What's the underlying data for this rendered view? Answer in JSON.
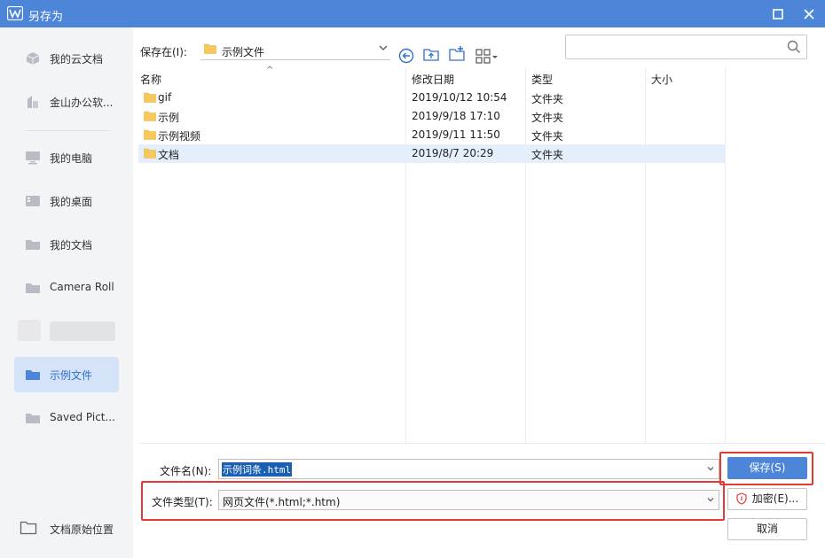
{
  "window": {
    "title": "另存为"
  },
  "sidebar": {
    "items": [
      {
        "label": "我的云文档"
      },
      {
        "label": "金山办公软..."
      },
      {
        "label": "我的电脑"
      },
      {
        "label": "我的桌面"
      },
      {
        "label": "我的文档"
      },
      {
        "label": "Camera Roll"
      },
      {
        "label": "示例文件"
      },
      {
        "label": "Saved Pict..."
      }
    ],
    "bottom_label": "文档原始位置"
  },
  "toolbar": {
    "save_in_label": "保存在(I):",
    "current_folder": "示例文件",
    "search_placeholder": ""
  },
  "filelist": {
    "columns": [
      "名称",
      "修改日期",
      "类型",
      "大小"
    ],
    "rows": [
      {
        "name": "gif",
        "date": "2019/10/12 10:54",
        "type": "文件夹"
      },
      {
        "name": "示例",
        "date": "2019/9/18 17:10",
        "type": "文件夹"
      },
      {
        "name": "示例视频",
        "date": "2019/9/11 11:50",
        "type": "文件夹"
      },
      {
        "name": "文档",
        "date": "2019/8/7 20:29",
        "type": "文件夹"
      }
    ]
  },
  "form": {
    "filename_label": "文件名(N):",
    "filename_value": "示例词条.html",
    "filetype_label": "文件类型(T):",
    "filetype_value": "网页文件(*.html;*.htm)"
  },
  "buttons": {
    "save": "保存(S)",
    "encrypt": "加密(E)...",
    "cancel": "取消"
  },
  "colors": {
    "accent": "#4d86d8",
    "highlight": "#e53935",
    "folder": "#f7c95c"
  }
}
